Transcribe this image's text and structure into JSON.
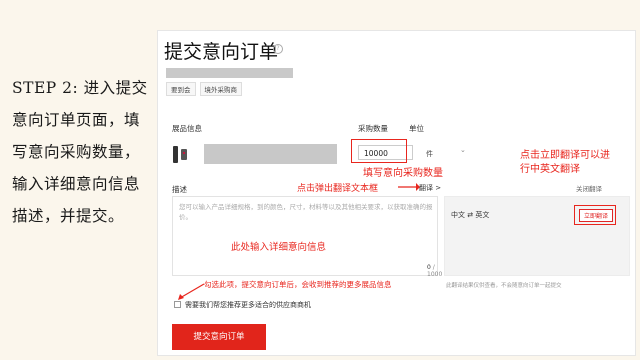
{
  "step_text": "STEP 2: 进入提交意向订单页面，填写意向采购数量，输入详细意向信息描述，并提交。",
  "page": {
    "title": "提交意向订单",
    "tabs": [
      "要到会",
      "境外采购商"
    ]
  },
  "form": {
    "product_label": "展品信息",
    "qty_label": "采购数量",
    "unit_label": "单位",
    "qty_value": "10000",
    "unit_value": "件",
    "desc_label": "描述",
    "desc_placeholder": "您可以输入产品详细规格，到的颜色，尺寸，材料等以及其他相关要求，以获取准确的报价。",
    "desc_count": "0",
    "desc_max": "/ 1000",
    "translate_link": "翻译 >",
    "close_translate": "关闭翻译",
    "lang_pair": "中文 ⇄ 英文",
    "translate_button": "立即翻译",
    "translate_note": "此翻译结果仅供查看，不会随意向订单一起提交",
    "checkbox_label": "需要我们帮您推荐更多适合的供应商商机",
    "submit_label": "提交意向订单"
  },
  "annotations": {
    "qty_hint": "填写意向采购数量",
    "popup_hint": "点击弹出翻译文本框",
    "translate_hint_line1": "点击立即翻译可以进",
    "translate_hint_line2": "行中英文翻译",
    "detail_hint": "此处输入详细意向信息",
    "check_hint": "勾选此项，提交意向订单后，会收到推荐的更多展品信息"
  },
  "colors": {
    "accent": "#e1251b",
    "annotation": "#e8261e",
    "slide_bg": "#fbf6ec"
  }
}
